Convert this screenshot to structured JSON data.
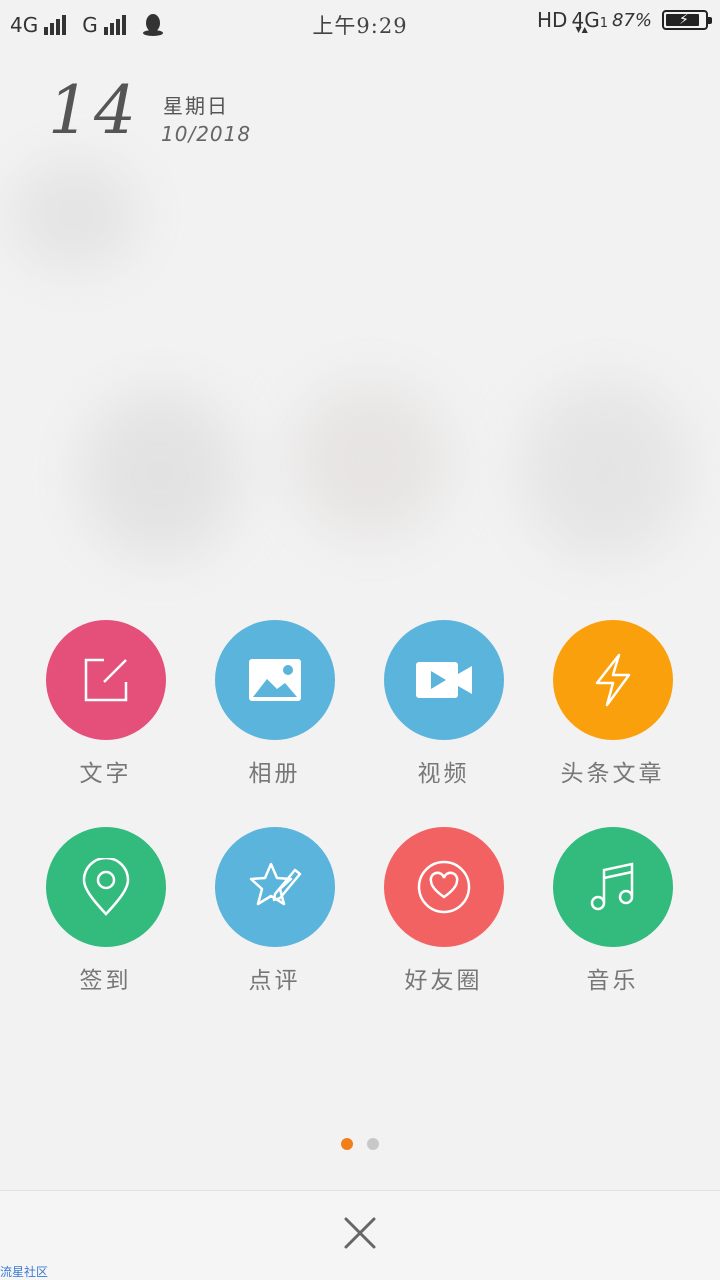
{
  "status_bar": {
    "network_left": "4G",
    "network_second": "G",
    "time": "上午9:29",
    "hd": "HD",
    "network_right": "4G",
    "network_right_sub": "1",
    "battery_percent": "87%",
    "battery_level": 0.87
  },
  "date": {
    "day": "14",
    "weekday": "星期日",
    "month_year": "10/2018"
  },
  "actions": [
    {
      "label": "文字",
      "icon": "edit-icon",
      "color": "#e4507a"
    },
    {
      "label": "相册",
      "icon": "photo-icon",
      "color": "#5ab4dc"
    },
    {
      "label": "视频",
      "icon": "video-icon",
      "color": "#5ab4dc"
    },
    {
      "label": "头条文章",
      "icon": "lightning-icon",
      "color": "#fba00d"
    },
    {
      "label": "签到",
      "icon": "location-pin-icon",
      "color": "#33bb7e"
    },
    {
      "label": "点评",
      "icon": "star-pen-icon",
      "color": "#5ab4dc"
    },
    {
      "label": "好友圈",
      "icon": "heart-circle-icon",
      "color": "#f36262"
    },
    {
      "label": "音乐",
      "icon": "music-note-icon",
      "color": "#33bb7e"
    }
  ],
  "pager": {
    "current": 1,
    "total": 2,
    "active_color": "#f07e1b"
  },
  "watermark": "流星社区"
}
